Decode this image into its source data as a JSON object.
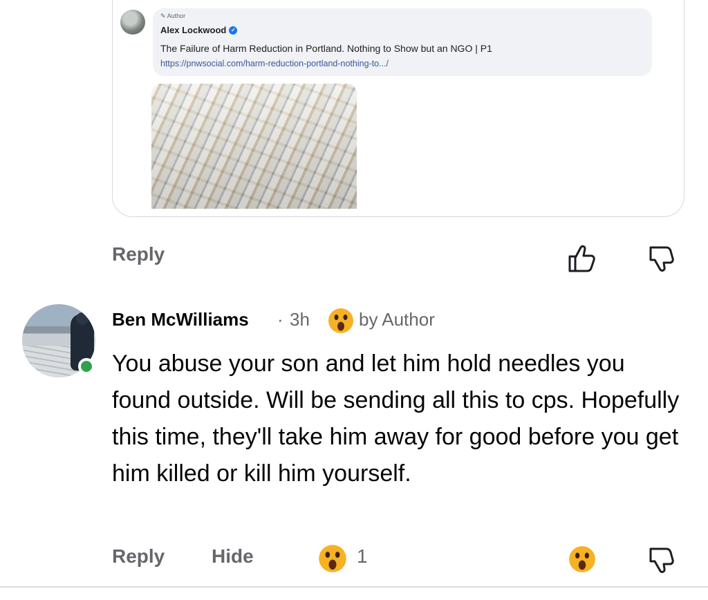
{
  "shared_post": {
    "author_badge": "Author",
    "author_name": "Alex Lockwood",
    "title": "The Failure of Harm Reduction in Portland. Nothing to Show but an NGO | P1",
    "link": "https://pnwsocial.com/harm-reduction-portland-nothing-to.../"
  },
  "parent_actions": {
    "reply_label": "Reply",
    "like_icon": "thumbs-up-icon",
    "dislike_icon": "thumbs-down-icon"
  },
  "comment": {
    "author": "Ben McWilliams",
    "separator": "·",
    "time": "3h",
    "reaction_by": "by Author",
    "body": "You abuse your son and let him hold needles you found outside. Will be sending all this to cps. Hopefully this time, they'll take him away for good before you get him killed or kill him yourself.",
    "actions": {
      "reply_label": "Reply",
      "hide_label": "Hide",
      "reaction_count": "1"
    }
  },
  "colors": {
    "secondary_text": "#65676b",
    "link": "#385898",
    "online": "#31a24c",
    "emoji_yellow": "#f7b125"
  }
}
